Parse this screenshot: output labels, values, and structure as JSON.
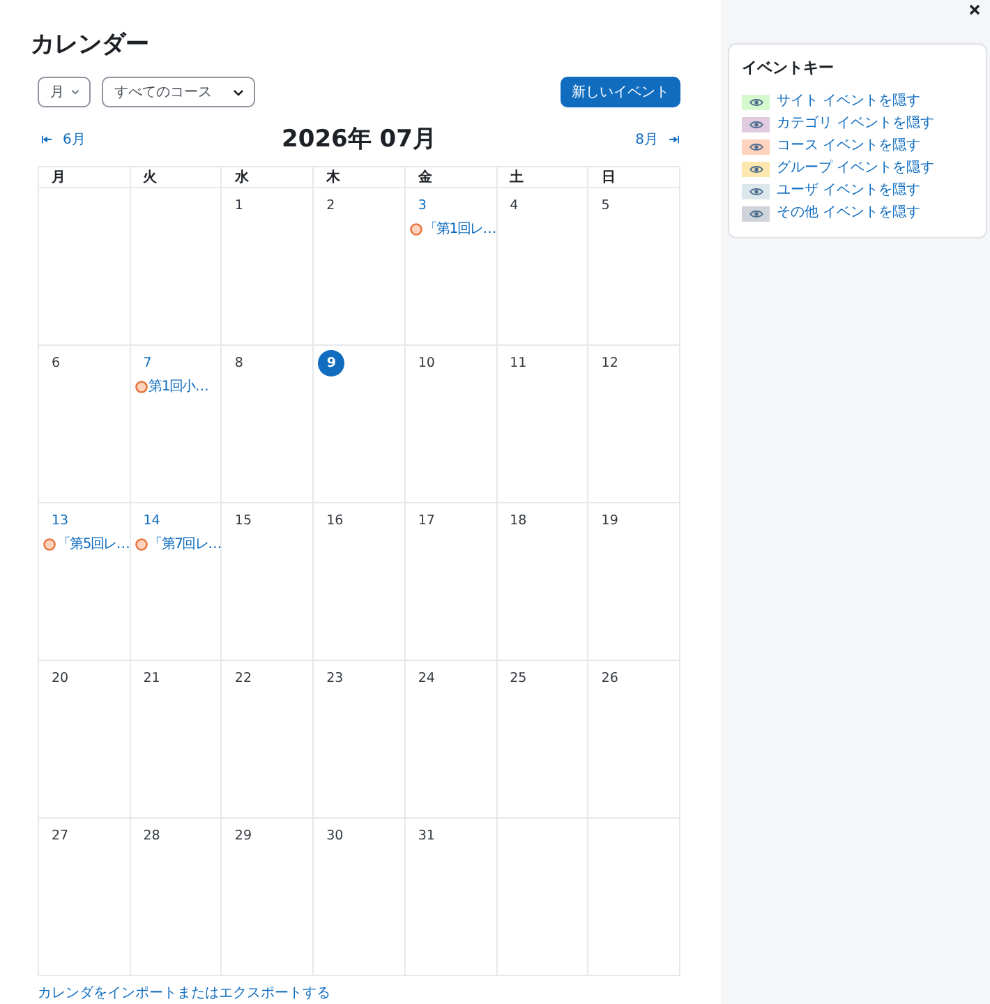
{
  "page": {
    "title": "カレンダー"
  },
  "controls": {
    "view_select": {
      "value": "月"
    },
    "course_select": {
      "value": "すべてのコース"
    },
    "new_event_button": "新しいイベント"
  },
  "navigation": {
    "previous": "6月",
    "title": "2026年 07月",
    "next": "8月"
  },
  "calendar": {
    "weekdays": [
      "月",
      "火",
      "水",
      "木",
      "金",
      "土",
      "日"
    ],
    "weeks": [
      [
        {
          "kind": "blank"
        },
        {
          "kind": "blank"
        },
        {
          "kind": "day",
          "day": "1",
          "today": false
        },
        {
          "kind": "day",
          "day": "2",
          "today": false
        },
        {
          "kind": "day",
          "day": "3",
          "today": false,
          "events": [
            {
              "title": "「第1回レ…",
              "kind": "course"
            }
          ]
        },
        {
          "kind": "day",
          "day": "4",
          "today": false
        },
        {
          "kind": "day",
          "day": "5",
          "today": false
        }
      ],
      [
        {
          "kind": "day",
          "day": "6",
          "today": false
        },
        {
          "kind": "day",
          "day": "7",
          "today": false,
          "events": [
            {
              "title": "第1回小…",
              "kind": "course"
            }
          ]
        },
        {
          "kind": "day",
          "day": "8",
          "today": false
        },
        {
          "kind": "day",
          "day": "9",
          "today": true
        },
        {
          "kind": "day",
          "day": "10",
          "today": false
        },
        {
          "kind": "day",
          "day": "11",
          "today": false
        },
        {
          "kind": "day",
          "day": "12",
          "today": false
        }
      ],
      [
        {
          "kind": "day",
          "day": "13",
          "today": false,
          "events": [
            {
              "title": "「第5回レ…",
              "kind": "course"
            }
          ]
        },
        {
          "kind": "day",
          "day": "14",
          "today": false,
          "events": [
            {
              "title": "「第7回レ…",
              "kind": "course"
            }
          ]
        },
        {
          "kind": "day",
          "day": "15",
          "today": false
        },
        {
          "kind": "day",
          "day": "16",
          "today": false
        },
        {
          "kind": "day",
          "day": "17",
          "today": false
        },
        {
          "kind": "day",
          "day": "18",
          "today": false
        },
        {
          "kind": "day",
          "day": "19",
          "today": false
        }
      ],
      [
        {
          "kind": "day",
          "day": "20",
          "today": false
        },
        {
          "kind": "day",
          "day": "21",
          "today": false
        },
        {
          "kind": "day",
          "day": "22",
          "today": false
        },
        {
          "kind": "day",
          "day": "23",
          "today": false
        },
        {
          "kind": "day",
          "day": "24",
          "today": false
        },
        {
          "kind": "day",
          "day": "25",
          "today": false
        },
        {
          "kind": "day",
          "day": "26",
          "today": false
        }
      ],
      [
        {
          "kind": "day",
          "day": "27",
          "today": false
        },
        {
          "kind": "day",
          "day": "28",
          "today": false
        },
        {
          "kind": "day",
          "day": "29",
          "today": false
        },
        {
          "kind": "day",
          "day": "30",
          "today": false
        },
        {
          "kind": "day",
          "day": "31",
          "today": false
        },
        {
          "kind": "blank"
        },
        {
          "kind": "blank"
        }
      ]
    ]
  },
  "footer_link": "カレンダをインポートまたはエクスポートする",
  "event_key": {
    "title": "イベントキー",
    "items": [
      {
        "label": "サイト イベントを隠す",
        "color": "#d6f8cd"
      },
      {
        "label": "カテゴリ イベントを隠す",
        "color": "#e0cbe0"
      },
      {
        "label": "コース イベントを隠す",
        "color": "#ffd3bd"
      },
      {
        "label": "グループ イベントを隠す",
        "color": "#fee7ae"
      },
      {
        "label": "ユーザ イベントを隠す",
        "color": "#dce7ec"
      },
      {
        "label": "その他 イベントを隠す",
        "color": "#ced4da"
      }
    ]
  }
}
